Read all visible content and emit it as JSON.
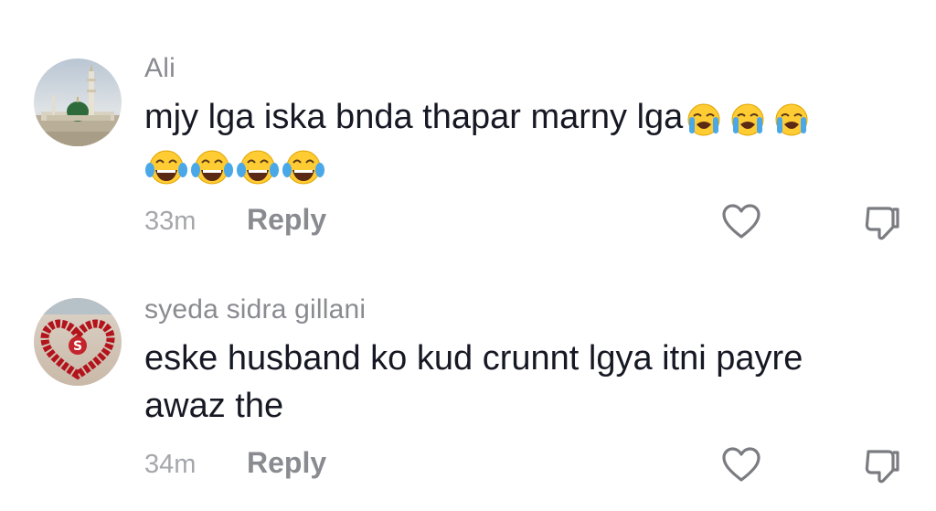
{
  "comments": [
    {
      "username": "Ali",
      "text": "mjy lga iska bnda thapar marny lga",
      "emojis_line1": [
        "loudly-crying-face",
        "loudly-crying-face",
        "loudly-crying-face"
      ],
      "emojis_line2": [
        "face-with-tears-of-joy",
        "face-with-tears-of-joy",
        "face-with-tears-of-joy",
        "face-with-tears-of-joy"
      ],
      "timestamp": "33m",
      "reply_label": "Reply",
      "avatar": "mosque-green-dome"
    },
    {
      "username": "syeda sidra gillani",
      "text_line1": "eske husband ko kud crunnt lgya itni payre",
      "text_line2": "awaz the",
      "timestamp": "34m",
      "reply_label": "Reply",
      "avatar": "rose-heart-letter-s"
    }
  ],
  "icons": {
    "like": "heart-outline-icon",
    "dislike": "thumbs-down-outline-icon"
  },
  "colors": {
    "username": "#8a8b91",
    "text": "#161823",
    "meta": "#a6a7ab"
  }
}
